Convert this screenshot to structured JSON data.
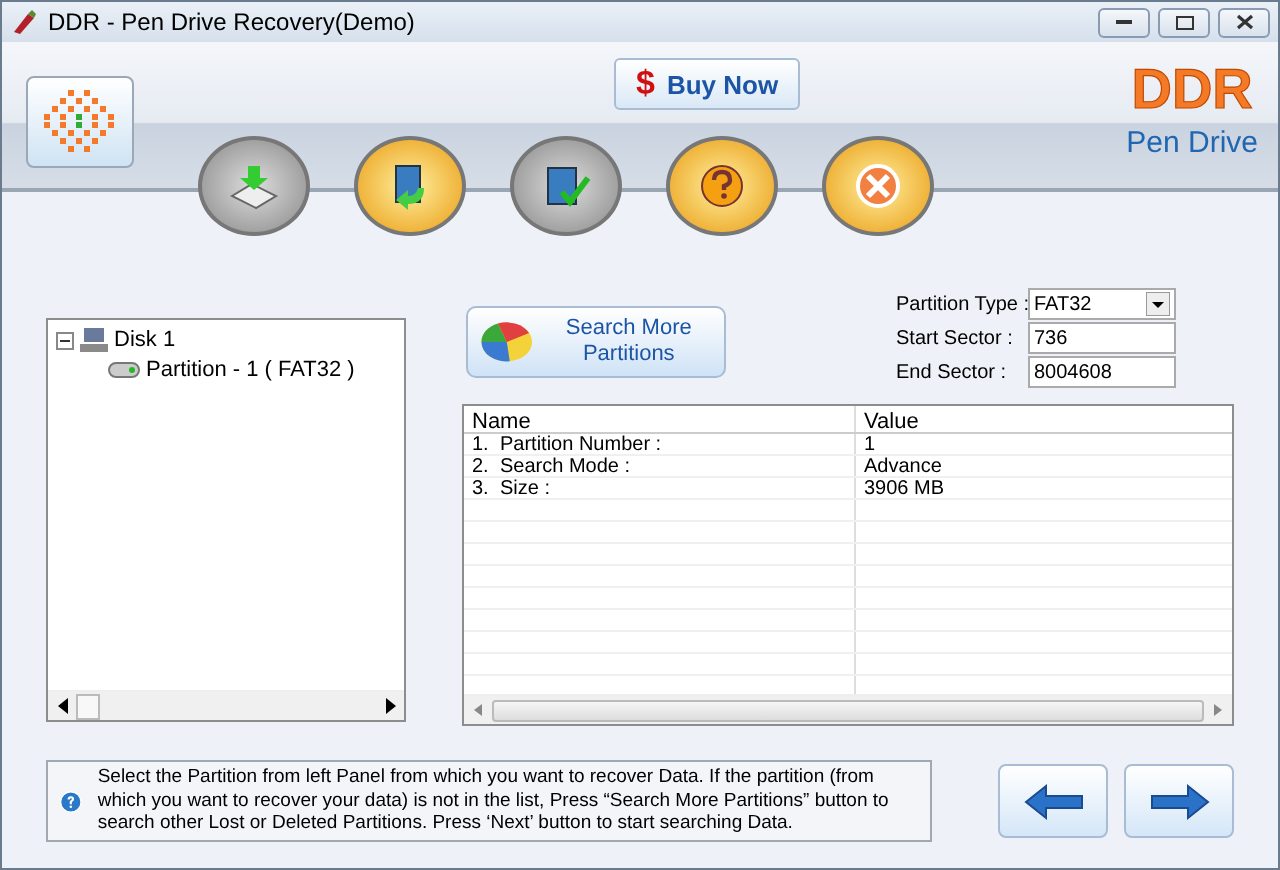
{
  "window": {
    "title": "DDR - Pen Drive Recovery(Demo)"
  },
  "header": {
    "buy_now": {
      "symbol": "$",
      "label": "Buy Now"
    },
    "brand": {
      "name": "DDR",
      "subtitle": "Pen Drive"
    }
  },
  "toolbar": [
    {
      "kind": "drive"
    },
    {
      "kind": "open"
    },
    {
      "kind": "check"
    },
    {
      "kind": "help"
    },
    {
      "kind": "exit"
    }
  ],
  "tree": [
    {
      "label": "Disk 1",
      "expanded": true,
      "children": [
        {
          "label": "Partition - 1 ( FAT32 )"
        }
      ]
    }
  ],
  "search_button": {
    "label": "Search More Partitions"
  },
  "fields": [
    {
      "label": "Partition Type :",
      "value": "FAT32",
      "kind": "dropdown"
    },
    {
      "label": "Start Sector :",
      "value": "736",
      "kind": "text"
    },
    {
      "label": "End Sector  :",
      "value": "8004608",
      "kind": "text"
    }
  ],
  "table": {
    "columns": [
      "Name",
      "Value"
    ],
    "rows": [
      {
        "number": "1.",
        "name": "Partition Number :",
        "value": "1"
      },
      {
        "number": "2.",
        "name": "Search Mode :",
        "value": "Advance"
      },
      {
        "number": "3.",
        "name": "Size :",
        "value": "3906 MB"
      }
    ]
  },
  "help": {
    "text": "Select the Partition from left Panel from which you want to recover Data. If the partition (from which you want to recover your data) is not in the list, Press “Search More Partitions” button to search other Lost or Deleted Partitions. Press ‘Next’ button to start searching Data."
  },
  "nav": [
    {
      "kind": "back"
    },
    {
      "kind": "next"
    }
  ]
}
